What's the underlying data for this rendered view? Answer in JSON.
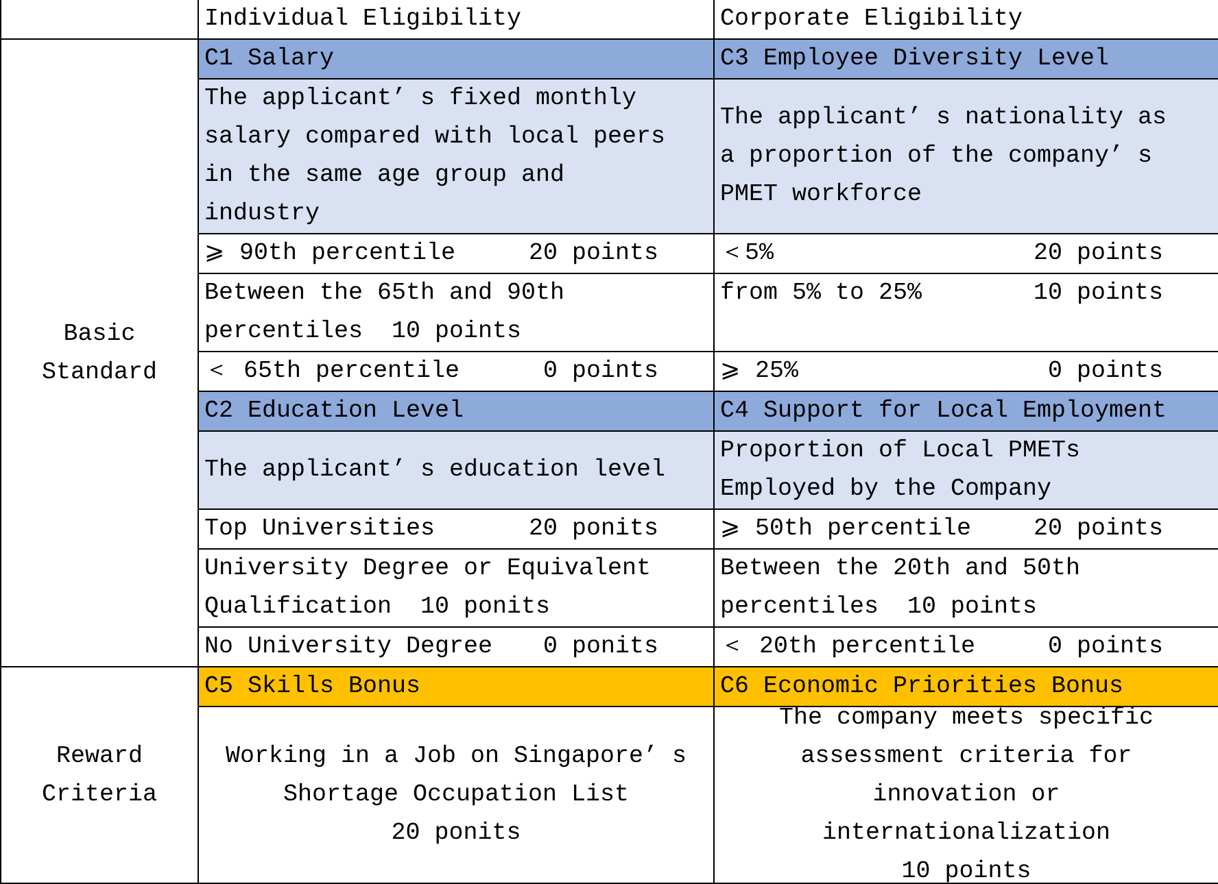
{
  "header": {
    "individual": "Individual Eligibility",
    "corporate": "Corporate Eligibility"
  },
  "sections": [
    {
      "label": "Basic Standard",
      "kind": "standard",
      "groups": [
        {
          "individual": {
            "title": "C1 Salary",
            "description": "The applicant’ s fixed monthly salary compared with local peers in the same age group and industry",
            "options": [
              {
                "kind": "split",
                "label": "⩾ 90th percentile",
                "points": "20 points"
              },
              {
                "kind": "inline",
                "label": "Between the 65th and 90th percentiles",
                "points": "10 points"
              },
              {
                "kind": "split",
                "label": "＜ 65th percentile",
                "points": "0 points"
              }
            ]
          },
          "corporate": {
            "title": "C3 Employee Diversity Level",
            "description": "The applicant’ s nationality as a proportion of the company’ s PMET workforce",
            "options": [
              {
                "kind": "split",
                "label": "＜5%",
                "points": "20 points"
              },
              {
                "kind": "split",
                "label": "from 5% to 25%",
                "points": "10 points"
              },
              {
                "kind": "split",
                "label": "⩾ 25%",
                "points": "0 points"
              }
            ]
          }
        },
        {
          "individual": {
            "title": "C2 Education Level",
            "description": "The applicant’ s education level",
            "options": [
              {
                "kind": "split",
                "label": "Top Universities",
                "points": "20 ponits"
              },
              {
                "kind": "inline",
                "label": "University Degree or Equivalent Qualification",
                "points": "10 ponits"
              },
              {
                "kind": "split",
                "label": "No University Degree",
                "points": "0 ponits"
              }
            ]
          },
          "corporate": {
            "title": "C4 Support for Local Employment",
            "description": "Proportion of Local PMETs Employed by the Company",
            "options": [
              {
                "kind": "split",
                "label": "⩾ 50th percentile",
                "points": "20 points"
              },
              {
                "kind": "inline",
                "label": "Between the 20th and 50th percentiles",
                "points": "10 points"
              },
              {
                "kind": "split",
                "label": "＜ 20th percentile",
                "points": "0 points"
              }
            ]
          }
        }
      ]
    },
    {
      "label": "Reward Criteria",
      "kind": "reward",
      "groups": [
        {
          "individual": {
            "title": "C5 Skills Bonus",
            "description": "Working in a Job on Singapore’ s Shortage Occupation List",
            "points": "20 ponits"
          },
          "corporate": {
            "title": "C6 Economic Priorities Bonus",
            "description": "The company meets specific assessment criteria for innovation or internationalization",
            "points": "10 points"
          }
        }
      ]
    }
  ]
}
